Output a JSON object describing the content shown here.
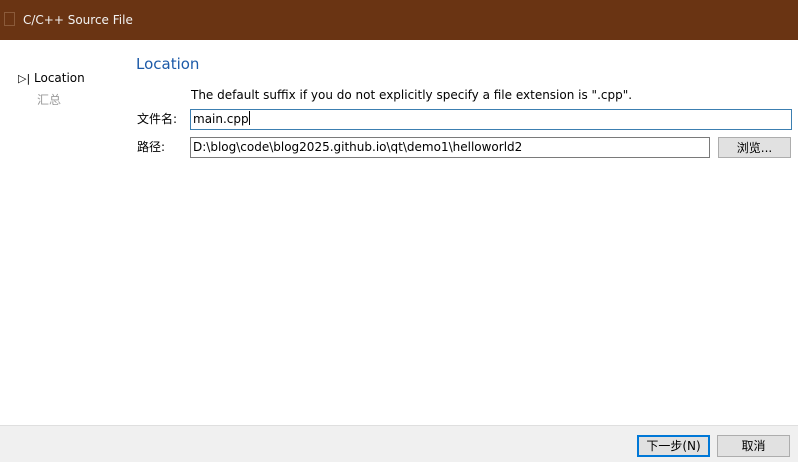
{
  "window": {
    "title": "C/C++ Source File",
    "icon": "app-icon",
    "colors": {
      "titlebar": "#6a3413",
      "heading": "#1c5aa8",
      "bottombar": "#f0f0f0"
    }
  },
  "steps": {
    "current_marker": "▷|",
    "items": [
      {
        "label": "Location",
        "state": "current"
      },
      {
        "label": "汇总",
        "state": "pending"
      }
    ]
  },
  "page": {
    "heading": "Location",
    "hint": "The default suffix if you do not explicitly specify a file extension is \".cpp\".",
    "filename": {
      "label": "文件名:",
      "value": "main.cpp"
    },
    "path": {
      "label": "路径:",
      "value": "D:\\blog\\code\\blog2025.github.io\\qt\\demo1\\helloworld2"
    },
    "browse_label": "浏览..."
  },
  "buttons": {
    "next_label": "下一步(N)",
    "cancel_label": "取消"
  }
}
